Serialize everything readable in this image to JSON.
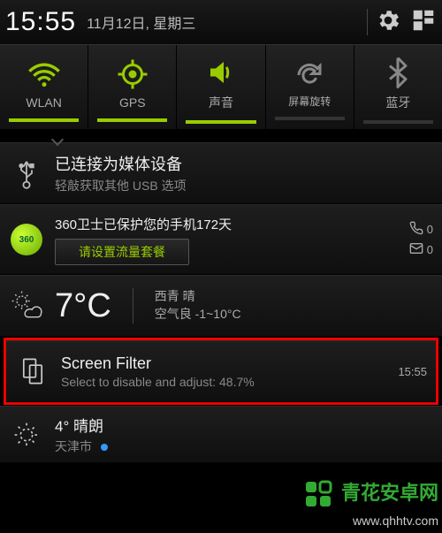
{
  "statusbar": {
    "time": "15:55",
    "date": "11月12日, 星期三"
  },
  "quick_settings": [
    {
      "label": "WLAN",
      "icon": "wifi",
      "active": true
    },
    {
      "label": "GPS",
      "icon": "gps",
      "active": true
    },
    {
      "label": "声音",
      "icon": "sound",
      "active": true
    },
    {
      "label": "屏幕旋转",
      "icon": "rotate",
      "active": false
    },
    {
      "label": "蓝牙",
      "icon": "bluetooth",
      "active": false
    }
  ],
  "notifications": {
    "usb": {
      "title": "已连接为媒体设备",
      "subtitle": "轻敲获取其他 USB 选项"
    },
    "security360": {
      "title": "360卫士已保护您的手机172天",
      "button": "请设置流量套餐",
      "missed_calls": "0",
      "unread_msgs": "0"
    },
    "weather": {
      "temp": "7°C",
      "line1": "西青 晴",
      "line2": "空气良 -1~10°C"
    },
    "screen_filter": {
      "title": "Screen Filter",
      "subtitle": "Select to disable and adjust: 48.7%",
      "time": "15:55"
    },
    "weather2": {
      "title": "4° 晴朗",
      "subtitle": "天津市"
    }
  },
  "watermark": {
    "line1": "青花安卓网",
    "line2": "www.qhhtv.com"
  }
}
